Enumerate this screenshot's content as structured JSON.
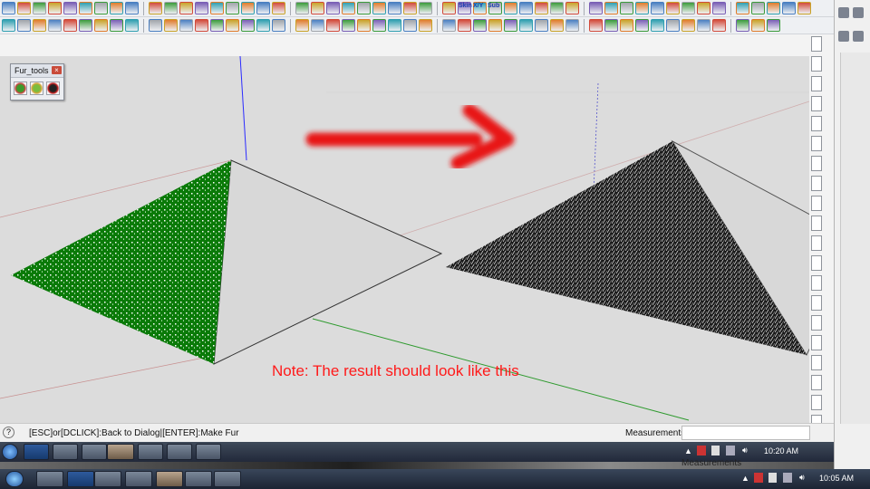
{
  "window": {
    "status_message": "[ESC]or[DCLICK]:Back to Dialog|[ENTER]:Make Fur",
    "measurements_label": "Measurements"
  },
  "fur_tools": {
    "title": "Fur_tools",
    "buttons": [
      "fur-tool-1-icon",
      "fur-tool-2-icon",
      "fur-tool-3-icon"
    ]
  },
  "annotation": {
    "note": "Note: The result should look like this"
  },
  "toolbar_icons": [
    "rectangle-icon",
    "circle-icon",
    "arc-icon",
    "polygon-icon",
    "move-icon",
    "rotate-icon",
    "push-pull-icon",
    "follow-me-icon",
    "offset-icon",
    "tape-icon",
    "paint-icon",
    "eraser-icon",
    "orbit-icon",
    "pan-icon",
    "zoom-icon",
    "camera-icon",
    "section-icon",
    "shadow-icon",
    "fog-icon",
    "style-icon",
    "layers-icon",
    "render-icon",
    "material-icon",
    "component-icon"
  ],
  "toolbar_labels": {
    "skin": "Skin",
    "xy": "X/Y",
    "sub": "Sub"
  },
  "taskbar_inner": {
    "clock": "10:20 AM",
    "apps": [
      "windows-start-icon",
      "photoshop-icon",
      "pdf-icon",
      "media-icon",
      "sketchup-icon",
      "explorer-icon",
      "chrome-icon",
      "window-icon"
    ]
  },
  "taskbar_outer": {
    "clock": "10:05 AM",
    "measurements_label": "Measurements",
    "apps": [
      "windows-start-icon",
      "firefox-icon",
      "photoshop-icon",
      "pdf-icon",
      "media-icon",
      "sketchup-icon",
      "explorer-icon",
      "chrome-icon",
      "window-icon"
    ]
  },
  "colors": {
    "fur_green": "#0a7a08",
    "fur_black": "#111111",
    "arrow_red": "#e81818",
    "note_red": "#ff1a1a",
    "canvas": "#dcdcdc"
  }
}
